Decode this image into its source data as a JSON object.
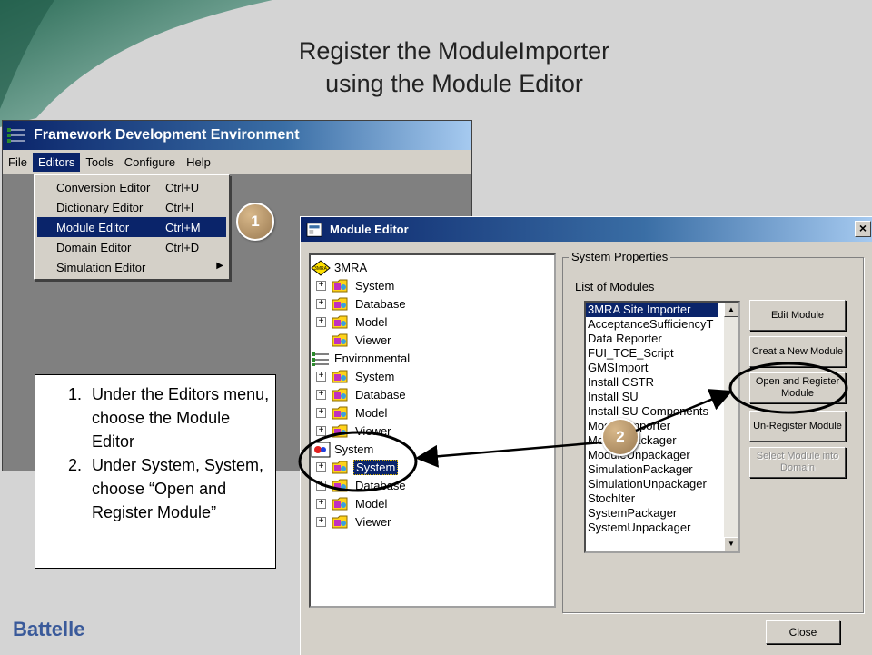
{
  "slide": {
    "title_line1": "Register the ModuleImporter",
    "title_line2": "using the Module Editor",
    "logo": "Battelle"
  },
  "fde": {
    "title": "Framework Development Environment",
    "menu": [
      "File",
      "Editors",
      "Tools",
      "Configure",
      "Help"
    ],
    "active_menu": "Editors",
    "editors_menu": [
      {
        "label": "Conversion Editor",
        "shortcut": "Ctrl+U"
      },
      {
        "label": "Dictionary Editor",
        "shortcut": "Ctrl+I"
      },
      {
        "label": "Module Editor",
        "shortcut": "Ctrl+M"
      },
      {
        "label": "Domain Editor",
        "shortcut": "Ctrl+D"
      },
      {
        "label": "Simulation Editor",
        "shortcut": ""
      }
    ]
  },
  "callouts": {
    "step1": "1",
    "step2": "2"
  },
  "instructions": {
    "items": [
      "Under the Editors menu, choose the Module Editor",
      "Under System, System, choose “Open and Register Module”"
    ]
  },
  "module_editor": {
    "title": "Module Editor",
    "close_glyph": "×",
    "tree": [
      {
        "label": "3MRA",
        "level": 0,
        "icon": "3mra-icon"
      },
      {
        "label": "System",
        "level": 1,
        "icon": "folder-icon"
      },
      {
        "label": "Database",
        "level": 1,
        "icon": "folder-icon"
      },
      {
        "label": "Model",
        "level": 1,
        "icon": "folder-icon"
      },
      {
        "label": "Viewer",
        "level": 1,
        "icon": "folder-icon"
      },
      {
        "label": "Environmental",
        "level": 0,
        "icon": "environmental-icon"
      },
      {
        "label": "System",
        "level": 1,
        "icon": "folder-icon"
      },
      {
        "label": "Database",
        "level": 1,
        "icon": "folder-icon"
      },
      {
        "label": "Model",
        "level": 1,
        "icon": "folder-icon"
      },
      {
        "label": "Viewer",
        "level": 1,
        "icon": "folder-icon"
      },
      {
        "label": "System",
        "level": 0,
        "icon": "system-icon"
      },
      {
        "label": "System",
        "level": 1,
        "icon": "folder-icon"
      },
      {
        "label": "Database",
        "level": 1,
        "icon": "folder-icon"
      },
      {
        "label": "Model",
        "level": 1,
        "icon": "folder-icon"
      },
      {
        "label": "Viewer",
        "level": 1,
        "icon": "folder-icon"
      }
    ],
    "system_properties": "System Properties",
    "list_label": "List of Modules",
    "modules": [
      "3MRA Site Importer",
      "AcceptanceSufficiencyT",
      "Data Reporter",
      "FUI_TCE_Script",
      "GMSImport",
      "Install CSTR",
      "Install SU",
      "Install SU Components",
      "ModuleImporter",
      "ModulePackager",
      "ModuleUnpackager",
      "SimulationPackager",
      "SimulationUnpackager",
      "StochIter",
      "SystemPackager",
      "SystemUnpackager"
    ],
    "buttons": {
      "edit": "Edit Module",
      "create": "Creat a New Module",
      "open_register": "Open and Register Module",
      "unregister": "Un-Register Module",
      "select_into_domain": "Select Module into Domain",
      "close": "Close"
    }
  }
}
